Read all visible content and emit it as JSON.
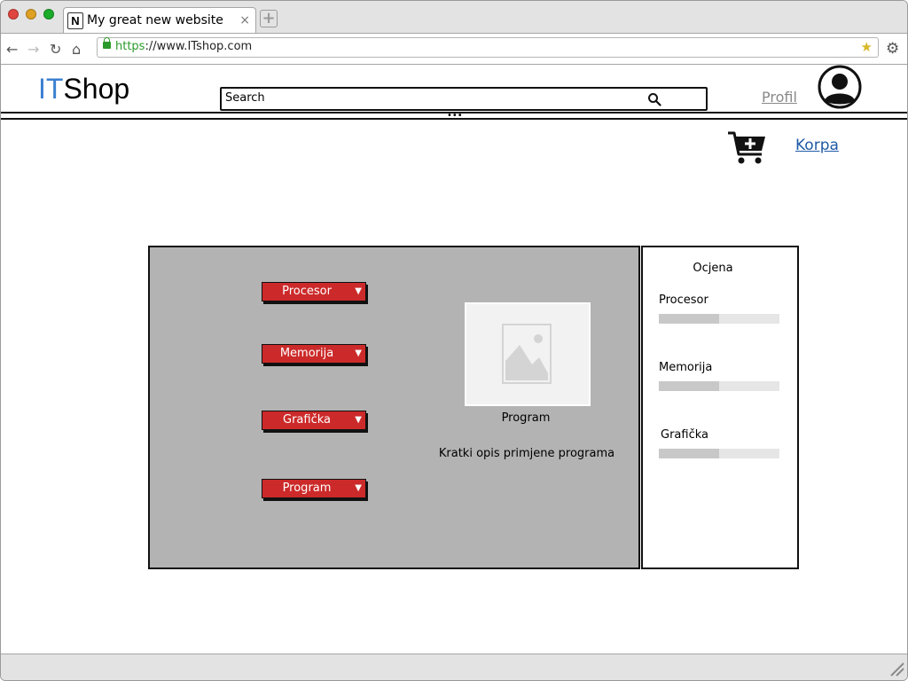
{
  "browser": {
    "tab_title": "My great new website",
    "favicon_letter": "N",
    "tab_close": "×",
    "new_tab": "+",
    "url_protocol": "https",
    "url_rest": "://www.ITshop.com",
    "traffic_lights": [
      "#e0443e",
      "#dea123",
      "#1aab29"
    ]
  },
  "header": {
    "logo_it": "IT",
    "logo_shop": "Shop",
    "logo_it_color": "#3b7fd1",
    "search_placeholder": "Search",
    "profile_link": "Profil",
    "cart_link": "Korpa"
  },
  "main": {
    "dropdowns": [
      {
        "label": "Procesor"
      },
      {
        "label": "Memorija"
      },
      {
        "label": "Grafička"
      },
      {
        "label": "Program"
      }
    ],
    "program_title": "Program",
    "program_description": "Kratki opis primjene programa",
    "dropdown_color": "#cc2a2a"
  },
  "rating": {
    "title": "Ocjena",
    "items": [
      {
        "label": "Procesor",
        "value": 0.5
      },
      {
        "label": "Memorija",
        "value": 0.5
      },
      {
        "label": "Grafička",
        "value": 0.5
      }
    ]
  }
}
